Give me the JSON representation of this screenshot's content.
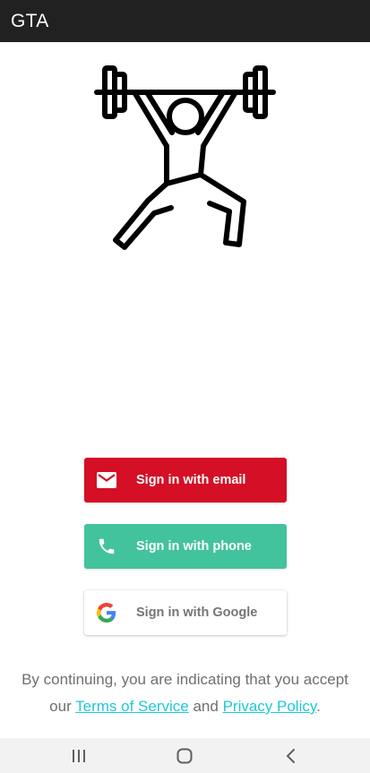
{
  "app": {
    "title": "GTA"
  },
  "hero": {
    "icon": "weightlifter-icon"
  },
  "buttons": {
    "email": {
      "label": "Sign in with email",
      "icon": "email-icon",
      "color": "#d50f25"
    },
    "phone": {
      "label": "Sign in with phone",
      "icon": "phone-icon",
      "color": "#42c39d"
    },
    "google": {
      "label": "Sign in with Google",
      "icon": "google-logo-icon",
      "color": "#ffffff"
    }
  },
  "legal": {
    "line1": "By continuing, you are indicating that you accept",
    "prefix": "our ",
    "terms_link": "Terms of Service",
    "conjunction": " and ",
    "privacy_link": "Privacy Policy",
    "suffix": ".",
    "link_color": "#1ec9d6"
  },
  "system_nav": {
    "recents": "recents-icon",
    "home": "home-icon",
    "back": "back-icon"
  }
}
